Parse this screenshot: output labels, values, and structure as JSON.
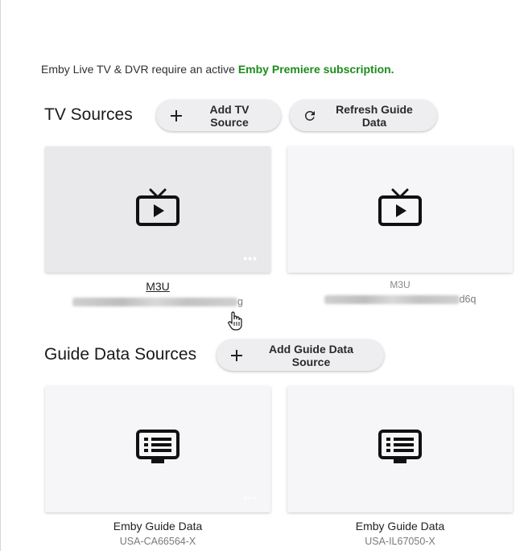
{
  "notice": {
    "prefix": "Emby Live TV & DVR require an active ",
    "link": "Emby Premiere subscription."
  },
  "tv_sources": {
    "title": "TV Sources",
    "add_label": "Add TV Source",
    "refresh_label": "Refresh Guide Data",
    "items": [
      {
        "title": "M3U",
        "sub_tail": "g",
        "icon": "live-tv-icon"
      },
      {
        "title": "M3U",
        "sub_tail": "d6q",
        "icon": "live-tv-icon"
      }
    ]
  },
  "guide_sources": {
    "title": "Guide Data Sources",
    "add_label": "Add Guide Data Source",
    "items": [
      {
        "title": "Emby Guide Data",
        "sub": "USA-CA66564-X",
        "icon": "guide-list-icon"
      },
      {
        "title": "Emby Guide Data",
        "sub": "USA-IL67050-X",
        "icon": "guide-list-icon"
      }
    ]
  },
  "icons": {
    "more": "more-horizontal-icon",
    "add": "plus-icon",
    "refresh": "refresh-icon",
    "cursor": "hand-pointer-icon"
  },
  "colors": {
    "accent_green": "#1c8c1c",
    "card_bg": "#f6f6f8",
    "button_bg": "#eeeef1"
  },
  "more_glyph": "•••"
}
